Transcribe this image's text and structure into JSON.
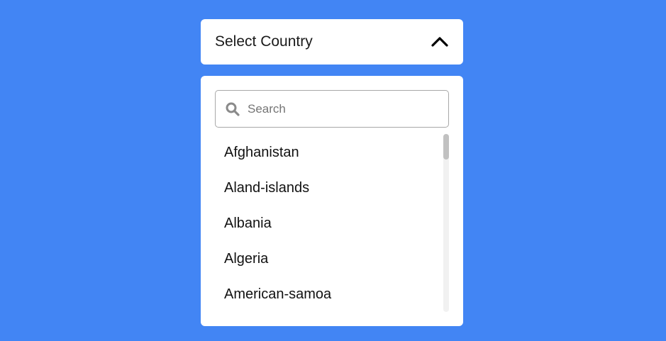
{
  "background_color": "#4285f4",
  "select": {
    "label": "Select Country",
    "icon": "chevron-up-icon"
  },
  "search": {
    "icon": "search-icon",
    "placeholder": "Search",
    "value": ""
  },
  "countries": [
    "Afghanistan",
    "Aland-islands",
    "Albania",
    "Algeria",
    "American-samoa"
  ]
}
